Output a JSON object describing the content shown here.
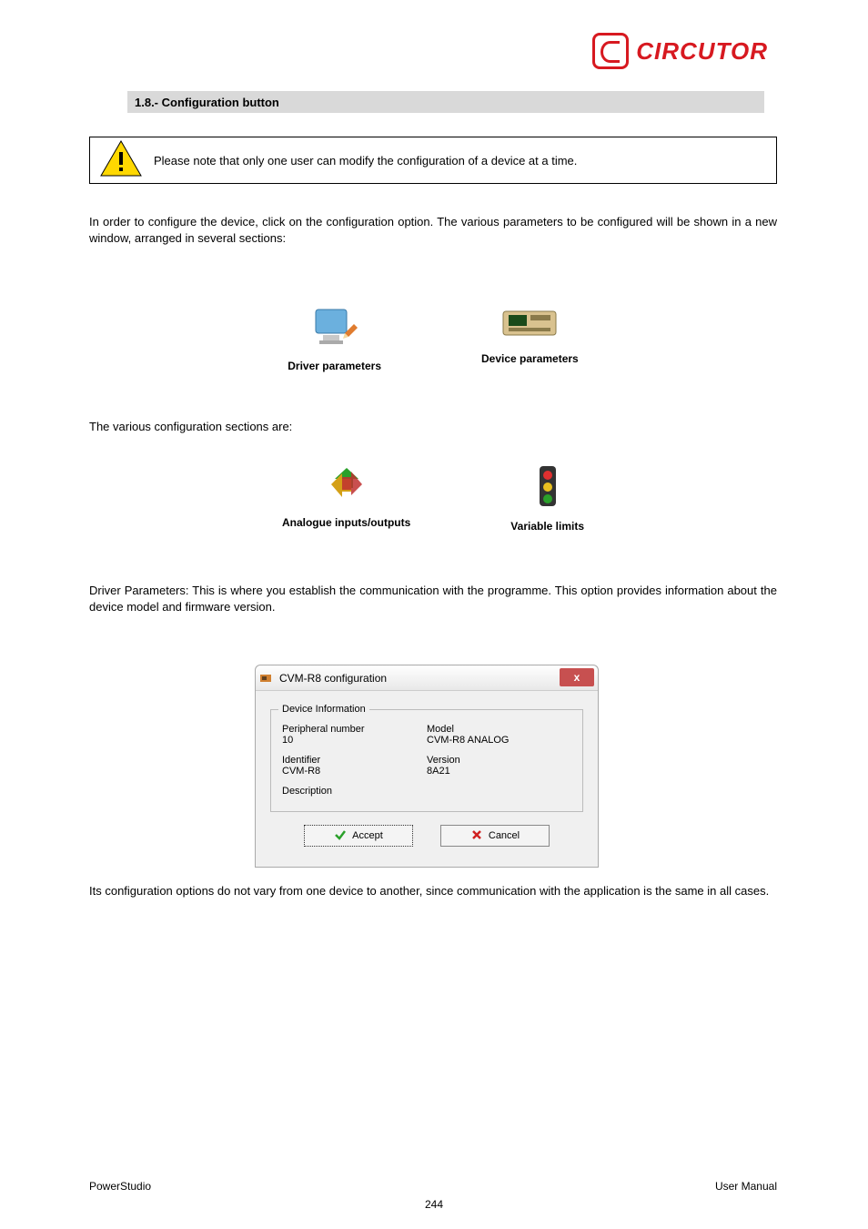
{
  "header": {
    "logo_text": "CIRCUTOR"
  },
  "section_bar": "1.8.- Configuration button",
  "warning": {
    "text": "Please note that only one user can modify the configuration of a device at a time."
  },
  "paragraphs": {
    "intro": "In order to configure the device, click on the configuration option. The various parameters to be configured will be shown in a new window, arranged in several sections:",
    "sections_intro": "The various configuration sections are:",
    "driver_params": "Driver Parameters: This is where you establish the communication with the programme. This option provides information about the device model and firmware version.",
    "driver_params2": "Its configuration options do not vary from one device to another, since communication with the application is the same in all cases."
  },
  "icons": {
    "driver_params": "Driver parameters",
    "device_params": "Device parameters",
    "analogue_io": "Analogue inputs/outputs",
    "variable_limits": "Variable limits"
  },
  "dialog": {
    "title": "CVM-R8 configuration",
    "legend": "Device Information",
    "peripheral_label": "Peripheral number",
    "peripheral_value": "10",
    "model_label": "Model",
    "model_value": "CVM-R8 ANALOG",
    "identifier_label": "Identifier",
    "identifier_value": "CVM-R8",
    "version_label": "Version",
    "version_value": "8A21",
    "description_label": "Description",
    "accept": "Accept",
    "cancel": "Cancel"
  },
  "footer": {
    "left": "PowerStudio",
    "right": "User Manual"
  },
  "page_number": "244"
}
